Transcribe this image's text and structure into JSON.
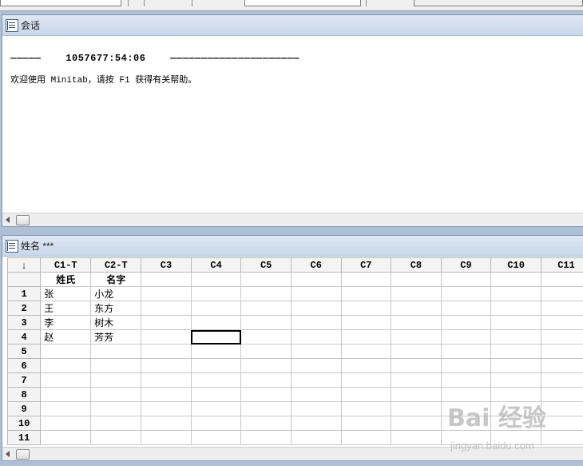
{
  "session": {
    "title": "会话",
    "timestamp_line": "—————    1057677:54:06    —————————————————————",
    "welcome_line": "欢迎使用 Minitab，请按 F1 获得有关帮助。"
  },
  "worksheet": {
    "title": "姓名 ***",
    "corner_label": "↓",
    "columns": [
      "C1-T",
      "C2-T",
      "C3",
      "C4",
      "C5",
      "C6",
      "C7",
      "C8",
      "C9",
      "C10",
      "C11"
    ],
    "column_names": [
      "姓氏",
      "名字",
      "",
      "",
      "",
      "",
      "",
      "",
      "",
      "",
      ""
    ],
    "rows": [
      {
        "num": "1",
        "c1": "张",
        "c2": "小龙"
      },
      {
        "num": "2",
        "c1": "王",
        "c2": "东方"
      },
      {
        "num": "3",
        "c1": "李",
        "c2": "树木"
      },
      {
        "num": "4",
        "c1": "赵",
        "c2": "芳芳"
      },
      {
        "num": "5",
        "c1": "",
        "c2": ""
      },
      {
        "num": "6",
        "c1": "",
        "c2": ""
      },
      {
        "num": "7",
        "c1": "",
        "c2": ""
      },
      {
        "num": "8",
        "c1": "",
        "c2": ""
      },
      {
        "num": "9",
        "c1": "",
        "c2": ""
      },
      {
        "num": "10",
        "c1": "",
        "c2": ""
      },
      {
        "num": "11",
        "c1": "",
        "c2": ""
      }
    ]
  },
  "watermark": {
    "brand": "Bai 经验",
    "url": "jingyan.baidu.com"
  }
}
